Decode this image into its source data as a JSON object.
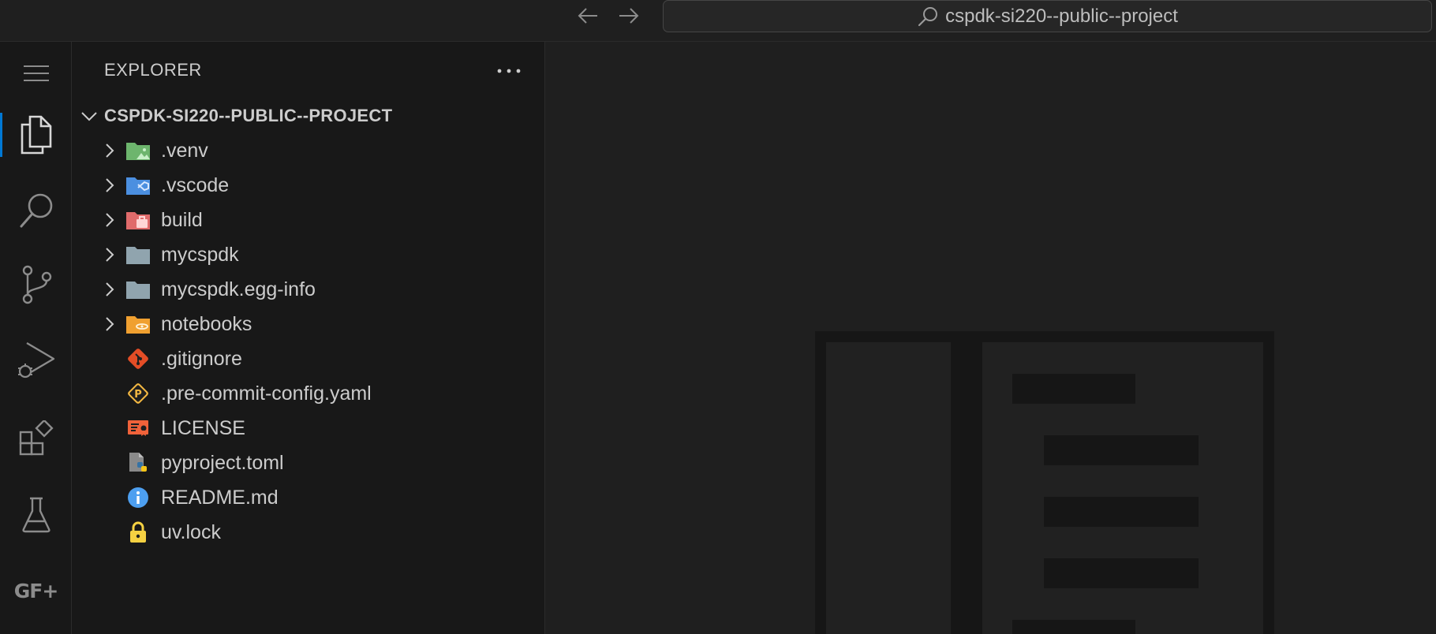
{
  "titlebar": {
    "search_text": "cspdk-si220--public--project",
    "back_icon": "arrow-left-icon",
    "forward_icon": "arrow-right-icon"
  },
  "activity_bar": {
    "items": [
      {
        "name": "menu",
        "icon": "hamburger-icon"
      },
      {
        "name": "explorer",
        "icon": "files-icon",
        "active": true
      },
      {
        "name": "search",
        "icon": "search-icon"
      },
      {
        "name": "source-control",
        "icon": "source-control-icon"
      },
      {
        "name": "run-debug",
        "icon": "run-debug-icon"
      },
      {
        "name": "extensions",
        "icon": "extensions-icon"
      },
      {
        "name": "testing",
        "icon": "flask-icon"
      },
      {
        "name": "gdsfactory",
        "label": "GF+"
      }
    ]
  },
  "sidebar": {
    "title": "EXPLORER",
    "project_name": "CSPDK-SI220--PUBLIC--PROJECT",
    "items": [
      {
        "label": ".venv",
        "type": "folder",
        "icon": "folder-venv-icon"
      },
      {
        "label": ".vscode",
        "type": "folder",
        "icon": "folder-vscode-icon"
      },
      {
        "label": "build",
        "type": "folder",
        "icon": "folder-build-icon"
      },
      {
        "label": "mycspdk",
        "type": "folder",
        "icon": "folder-icon"
      },
      {
        "label": "mycspdk.egg-info",
        "type": "folder",
        "icon": "folder-icon"
      },
      {
        "label": "notebooks",
        "type": "folder",
        "icon": "folder-notebooks-icon"
      },
      {
        "label": ".gitignore",
        "type": "file",
        "icon": "git-icon"
      },
      {
        "label": ".pre-commit-config.yaml",
        "type": "file",
        "icon": "pre-commit-icon"
      },
      {
        "label": "LICENSE",
        "type": "file",
        "icon": "license-icon"
      },
      {
        "label": "pyproject.toml",
        "type": "file",
        "icon": "python-toml-icon"
      },
      {
        "label": "README.md",
        "type": "file",
        "icon": "info-icon"
      },
      {
        "label": "uv.lock",
        "type": "file",
        "icon": "lock-icon"
      }
    ]
  },
  "colors": {
    "accent": "#0078d4",
    "background": "#1f1f1f",
    "sidebar": "#181818",
    "text": "#cccccc"
  }
}
